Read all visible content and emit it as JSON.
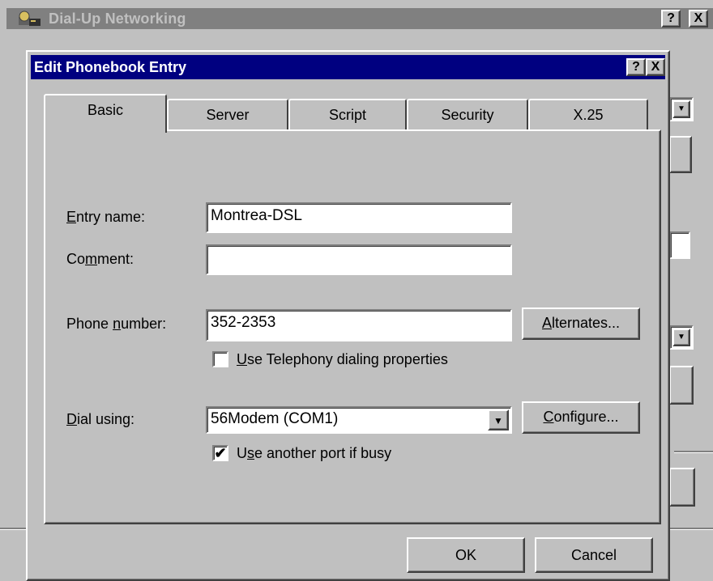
{
  "background_window": {
    "title": "Dial-Up Networking",
    "help_label": "?",
    "close_label": "X"
  },
  "dialog": {
    "title": "Edit Phonebook Entry",
    "help_label": "?",
    "close_label": "X",
    "tabs": [
      {
        "label": "Basic",
        "active": true
      },
      {
        "label": "Server",
        "active": false
      },
      {
        "label": "Script",
        "active": false
      },
      {
        "label": "Security",
        "active": false
      },
      {
        "label": "X.25",
        "active": false
      }
    ],
    "entry_name": {
      "label_accel": "E",
      "label_rest": "ntry name:",
      "value": "Montrea-DSL"
    },
    "comment": {
      "label_pre": "Co",
      "label_accel": "m",
      "label_rest": "ment:",
      "value": ""
    },
    "phone_number": {
      "label_pre": "Phone ",
      "label_accel": "n",
      "label_rest": "umber:",
      "value": "352-2353"
    },
    "alternates_button": {
      "accel": "A",
      "rest": "lternates..."
    },
    "use_telephony": {
      "accel": "U",
      "rest": "se Telephony dialing properties",
      "checked": false
    },
    "dial_using": {
      "label_accel": "D",
      "label_rest": "ial using:",
      "value": "56Modem (COM1)"
    },
    "configure_button": {
      "accel": "C",
      "rest": "onfigure..."
    },
    "use_another_port": {
      "pre": "U",
      "accel": "s",
      "rest": "e another port if busy",
      "checked": true
    },
    "ok_label": "OK",
    "cancel_label": "Cancel"
  }
}
